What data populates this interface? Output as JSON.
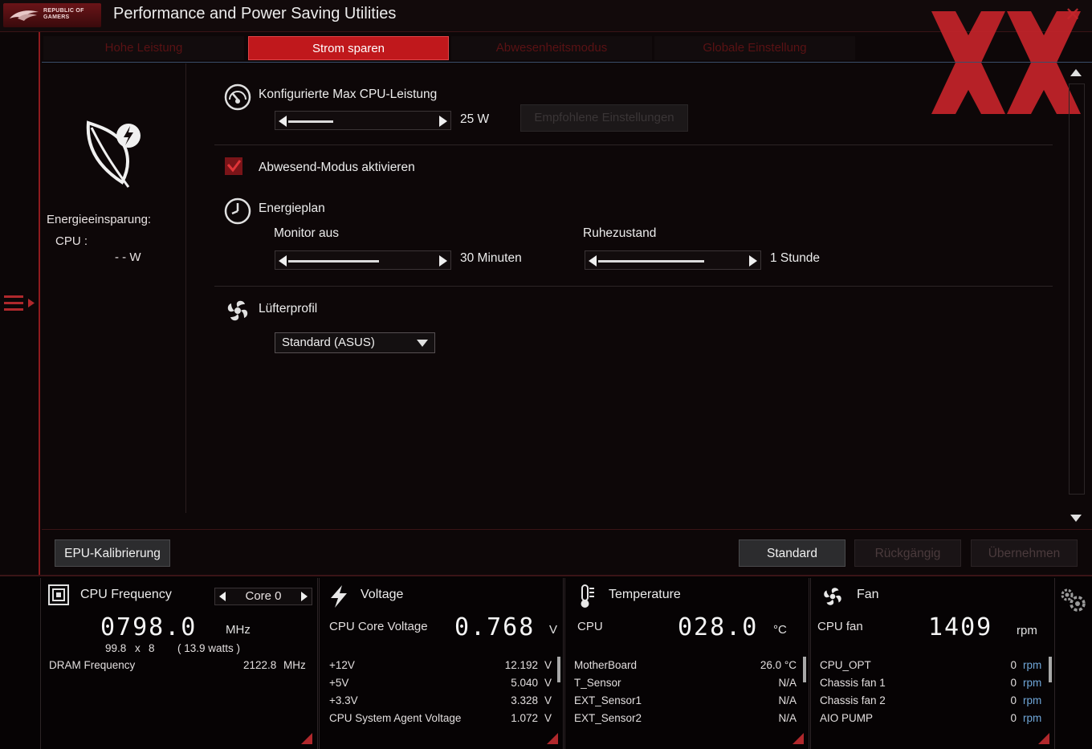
{
  "window": {
    "brand_line1": "REPUBLIC OF",
    "brand_line2": "GAMERS",
    "title": "Performance and Power Saving Utilities"
  },
  "tabs": [
    {
      "label": "Hohe Leistung"
    },
    {
      "label": "Strom sparen"
    },
    {
      "label": "Abwesenheitsmodus"
    },
    {
      "label": "Globale Einstellung"
    }
  ],
  "sidebar": {
    "energy_label": "Energieeinsparung:",
    "cpu_label": "CPU :",
    "cpu_value": "- - W"
  },
  "settings": {
    "max_cpu_label": "Konfigurierte Max CPU-Leistung",
    "max_cpu_value": "25 W",
    "max_cpu_slider_fraction": 0.3,
    "recommended_button": "Empfohlene Einstellungen",
    "away_mode_label": "Abwesend-Modus aktivieren",
    "away_mode_checked": true,
    "power_plan_label": "Energieplan",
    "monitor_off_label": "Monitor aus",
    "monitor_off_value": "30 Minuten",
    "monitor_off_fraction": 0.6,
    "sleep_label": "Ruhezustand",
    "sleep_value": "1 Stunde",
    "sleep_fraction": 0.7,
    "fan_profile_label": "Lüfterprofil",
    "fan_profile_value": "Standard (ASUS)"
  },
  "footer": {
    "epu_button": "EPU-Kalibrierung",
    "standard_button": "Standard",
    "undo_button": "Rückgängig",
    "apply_button": "Übernehmen"
  },
  "monitor": {
    "cpu": {
      "title": "CPU Frequency",
      "core_select": "Core 0",
      "freq": "0798.0",
      "freq_unit": "MHz",
      "multiplier_base": "99.8",
      "multiplier_x": "x",
      "multiplier": "8",
      "watts": "( 13.9 watts )",
      "dram_label": "DRAM Frequency",
      "dram_value": "2122.8",
      "dram_unit": "MHz"
    },
    "voltage": {
      "title": "Voltage",
      "core_label": "CPU Core Voltage",
      "core_value": "0.768",
      "core_unit": "V",
      "rows": [
        {
          "label": "+12V",
          "value": "12.192",
          "unit": "V"
        },
        {
          "label": "+5V",
          "value": "5.040",
          "unit": "V"
        },
        {
          "label": "+3.3V",
          "value": "3.328",
          "unit": "V"
        },
        {
          "label": "CPU System Agent Voltage",
          "value": "1.072",
          "unit": "V"
        }
      ]
    },
    "temperature": {
      "title": "Temperature",
      "cpu_label": "CPU",
      "cpu_value": "028.0",
      "cpu_unit": "°C",
      "rows": [
        {
          "label": "MotherBoard",
          "value": "26.0 °C"
        },
        {
          "label": "T_Sensor",
          "value": "N/A"
        },
        {
          "label": "EXT_Sensor1",
          "value": "N/A"
        },
        {
          "label": "EXT_Sensor2",
          "value": "N/A"
        }
      ]
    },
    "fan": {
      "title": "Fan",
      "cpu_label": "CPU fan",
      "cpu_value": "1409",
      "cpu_unit": "rpm",
      "rows": [
        {
          "label": "CPU_OPT",
          "value": "0",
          "unit": "rpm"
        },
        {
          "label": "Chassis fan 1",
          "value": "0",
          "unit": "rpm"
        },
        {
          "label": "Chassis fan 2",
          "value": "0",
          "unit": "rpm"
        },
        {
          "label": "AIO PUMP",
          "value": "0",
          "unit": "rpm"
        }
      ]
    }
  },
  "colors": {
    "accent": "#c0181c",
    "background": "#0d0708",
    "rpm_blue": "#6fa6d8"
  },
  "icons": [
    "rog-logo-icon",
    "close-icon",
    "menu-expand-icon",
    "leaf-power-icon",
    "speedometer-icon",
    "clock-icon",
    "fan-icon",
    "cpu-chip-icon",
    "lightning-icon",
    "thermometer-icon",
    "gear-icon"
  ]
}
